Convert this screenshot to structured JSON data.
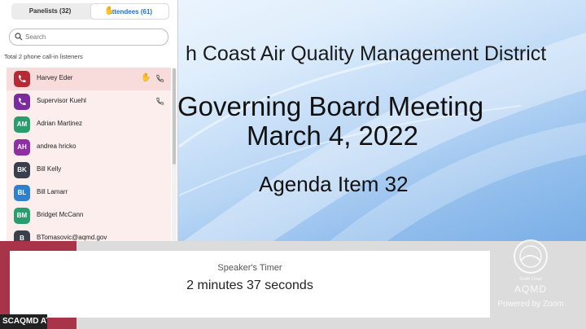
{
  "slide": {
    "org": "h Coast Air Quality Management District",
    "title": "Governing Board Meeting",
    "date": "March 4, 2022",
    "agenda": "Agenda Item 32"
  },
  "panel": {
    "tabs": [
      {
        "label": "Panelists (32)"
      },
      {
        "label": "Attendees (61)",
        "active": true
      }
    ],
    "search": {
      "placeholder": "Search"
    },
    "callin_note": "Total 2 phone call-in listeners",
    "attendees": [
      {
        "name": "Harvey Eder",
        "avatar_icon": "phone-icon",
        "color": "#b52a35",
        "hand_raised": true,
        "phone": true,
        "selected": true
      },
      {
        "name": "Supervisor Kuehl",
        "avatar_icon": "phone-icon",
        "color": "#7a2c9e",
        "hand_raised": false,
        "phone": true
      },
      {
        "name": "Adrian Martinez",
        "initials": "AM",
        "color": "#2a9d6f"
      },
      {
        "name": "andrea hricko",
        "initials": "AH",
        "color": "#8e2fa3"
      },
      {
        "name": "Bill Kelly",
        "initials": "BK",
        "color": "#3a3f4b"
      },
      {
        "name": "Bill Lamarr",
        "initials": "BL",
        "color": "#2f80cf"
      },
      {
        "name": "Bridget McCann",
        "initials": "BM",
        "color": "#2a9d6f"
      },
      {
        "name": "BTomasovic@aqmd.gov",
        "initials": "B",
        "color": "#3a3f4b"
      }
    ]
  },
  "timer": {
    "label": "Speaker's Timer",
    "value": "2 minutes 37 seconds"
  },
  "name_tag": "SCAQMD AT",
  "watermark": {
    "small_text": "South Coast",
    "org": "AQMD",
    "powered_by": "Powered by Zoom"
  },
  "colors": {
    "accent": "#1f6fd1",
    "timer_border": "#a8344a",
    "raise_hand": "#e0a800"
  }
}
